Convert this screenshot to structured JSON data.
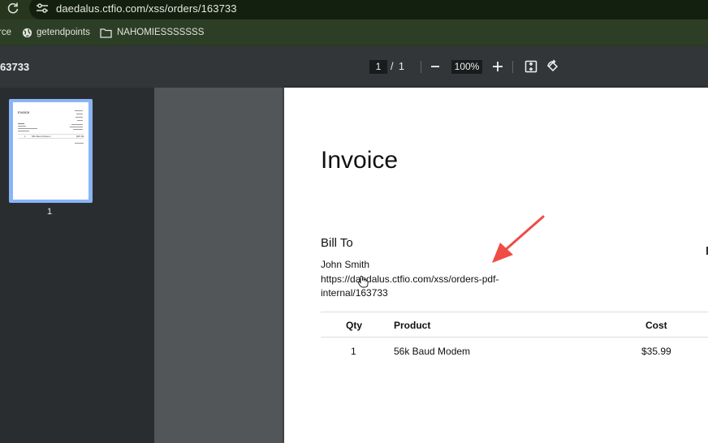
{
  "browser": {
    "url": "daedalus.ctfio.com/xss/orders/163733",
    "icons": {
      "reload": "reload-icon",
      "site_info": "tune-icon"
    }
  },
  "bookmarks": [
    {
      "label": "rce",
      "icon": ""
    },
    {
      "label": "getendpoints",
      "icon": "globe-icon"
    },
    {
      "label": "NAHOMIESSSSSSS",
      "icon": "folder-icon"
    }
  ],
  "pdf_toolbar": {
    "title": "63733",
    "current_page": "1",
    "page_separator": "/",
    "total_pages": "1",
    "zoom": "100%",
    "icons": {
      "zoom_out": "minus-icon",
      "zoom_in": "plus-icon",
      "fit": "fit-to-page-icon",
      "rotate": "rotate-icon"
    }
  },
  "sidebar": {
    "thumbnail_label": "1",
    "thumbnail_mini": {
      "title": "Invoice",
      "row_qty": "1",
      "row_product": "56k Baud Modem",
      "row_cost": "$35.99"
    }
  },
  "invoice": {
    "title": "Invoice",
    "bill_to_heading": "Bill To",
    "customer_name": "John Smith",
    "customer_address": "https://daedalus.ctfio.com/xss/orders-pdf-internal/163733",
    "table": {
      "headers": {
        "qty": "Qty",
        "product": "Product",
        "cost": "Cost"
      },
      "rows": [
        {
          "qty": "1",
          "product": "56k Baud Modem",
          "cost": "$35.99"
        }
      ]
    }
  },
  "annotation": {
    "arrow_color": "#f04b45"
  },
  "colors": {
    "address_bar": "#26361f",
    "bookmarks_bar": "#2d3e27",
    "pdf_toolbar": "#323639",
    "thumbnail_highlight": "#8ab4f8"
  }
}
